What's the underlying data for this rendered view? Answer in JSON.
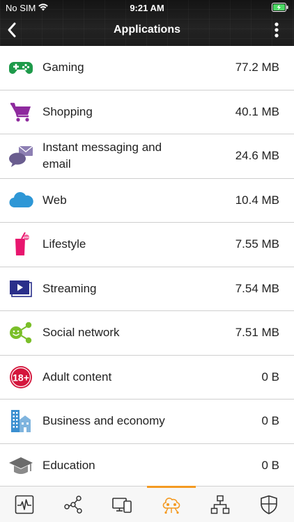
{
  "status": {
    "carrier": "No SIM",
    "time": "9:21 AM"
  },
  "header": {
    "title": "Applications"
  },
  "apps": [
    {
      "label": "Gaming",
      "size": "77.2 MB",
      "icon": "gamepad-icon"
    },
    {
      "label": "Shopping",
      "size": "40.1 MB",
      "icon": "shopping-cart-icon"
    },
    {
      "label": "Instant messaging and email",
      "size": "24.6 MB",
      "icon": "chat-mail-icon"
    },
    {
      "label": "Web",
      "size": "10.4 MB",
      "icon": "cloud-icon"
    },
    {
      "label": "Lifestyle",
      "size": "7.55 MB",
      "icon": "drink-icon"
    },
    {
      "label": "Streaming",
      "size": "7.54 MB",
      "icon": "video-play-icon"
    },
    {
      "label": "Social network",
      "size": "7.51 MB",
      "icon": "social-share-icon"
    },
    {
      "label": "Adult content",
      "size": "0 B",
      "icon": "adult-18-icon",
      "icon_text": "18+"
    },
    {
      "label": "Business and economy",
      "size": "0 B",
      "icon": "buildings-icon"
    },
    {
      "label": "Education",
      "size": "0 B",
      "icon": "graduation-cap-icon"
    }
  ],
  "tabs": [
    {
      "icon": "activity-monitor-icon",
      "active": false
    },
    {
      "icon": "network-nodes-icon",
      "active": false
    },
    {
      "icon": "devices-icon",
      "active": false
    },
    {
      "icon": "applications-icon",
      "active": true
    },
    {
      "icon": "topology-icon",
      "active": false
    },
    {
      "icon": "shield-icon",
      "active": false
    }
  ],
  "colors": {
    "accent": "#f49a22",
    "gaming": "#1e9a4a",
    "shopping": "#8e2a9e",
    "messaging": "#6a5d8f",
    "web": "#2e97d6",
    "lifestyle": "#e8166e",
    "streaming": "#2a2f8a",
    "social": "#7bbf2a",
    "adult": "#d4163c",
    "business": "#3a8fd0",
    "education": "#6b6b6b"
  }
}
